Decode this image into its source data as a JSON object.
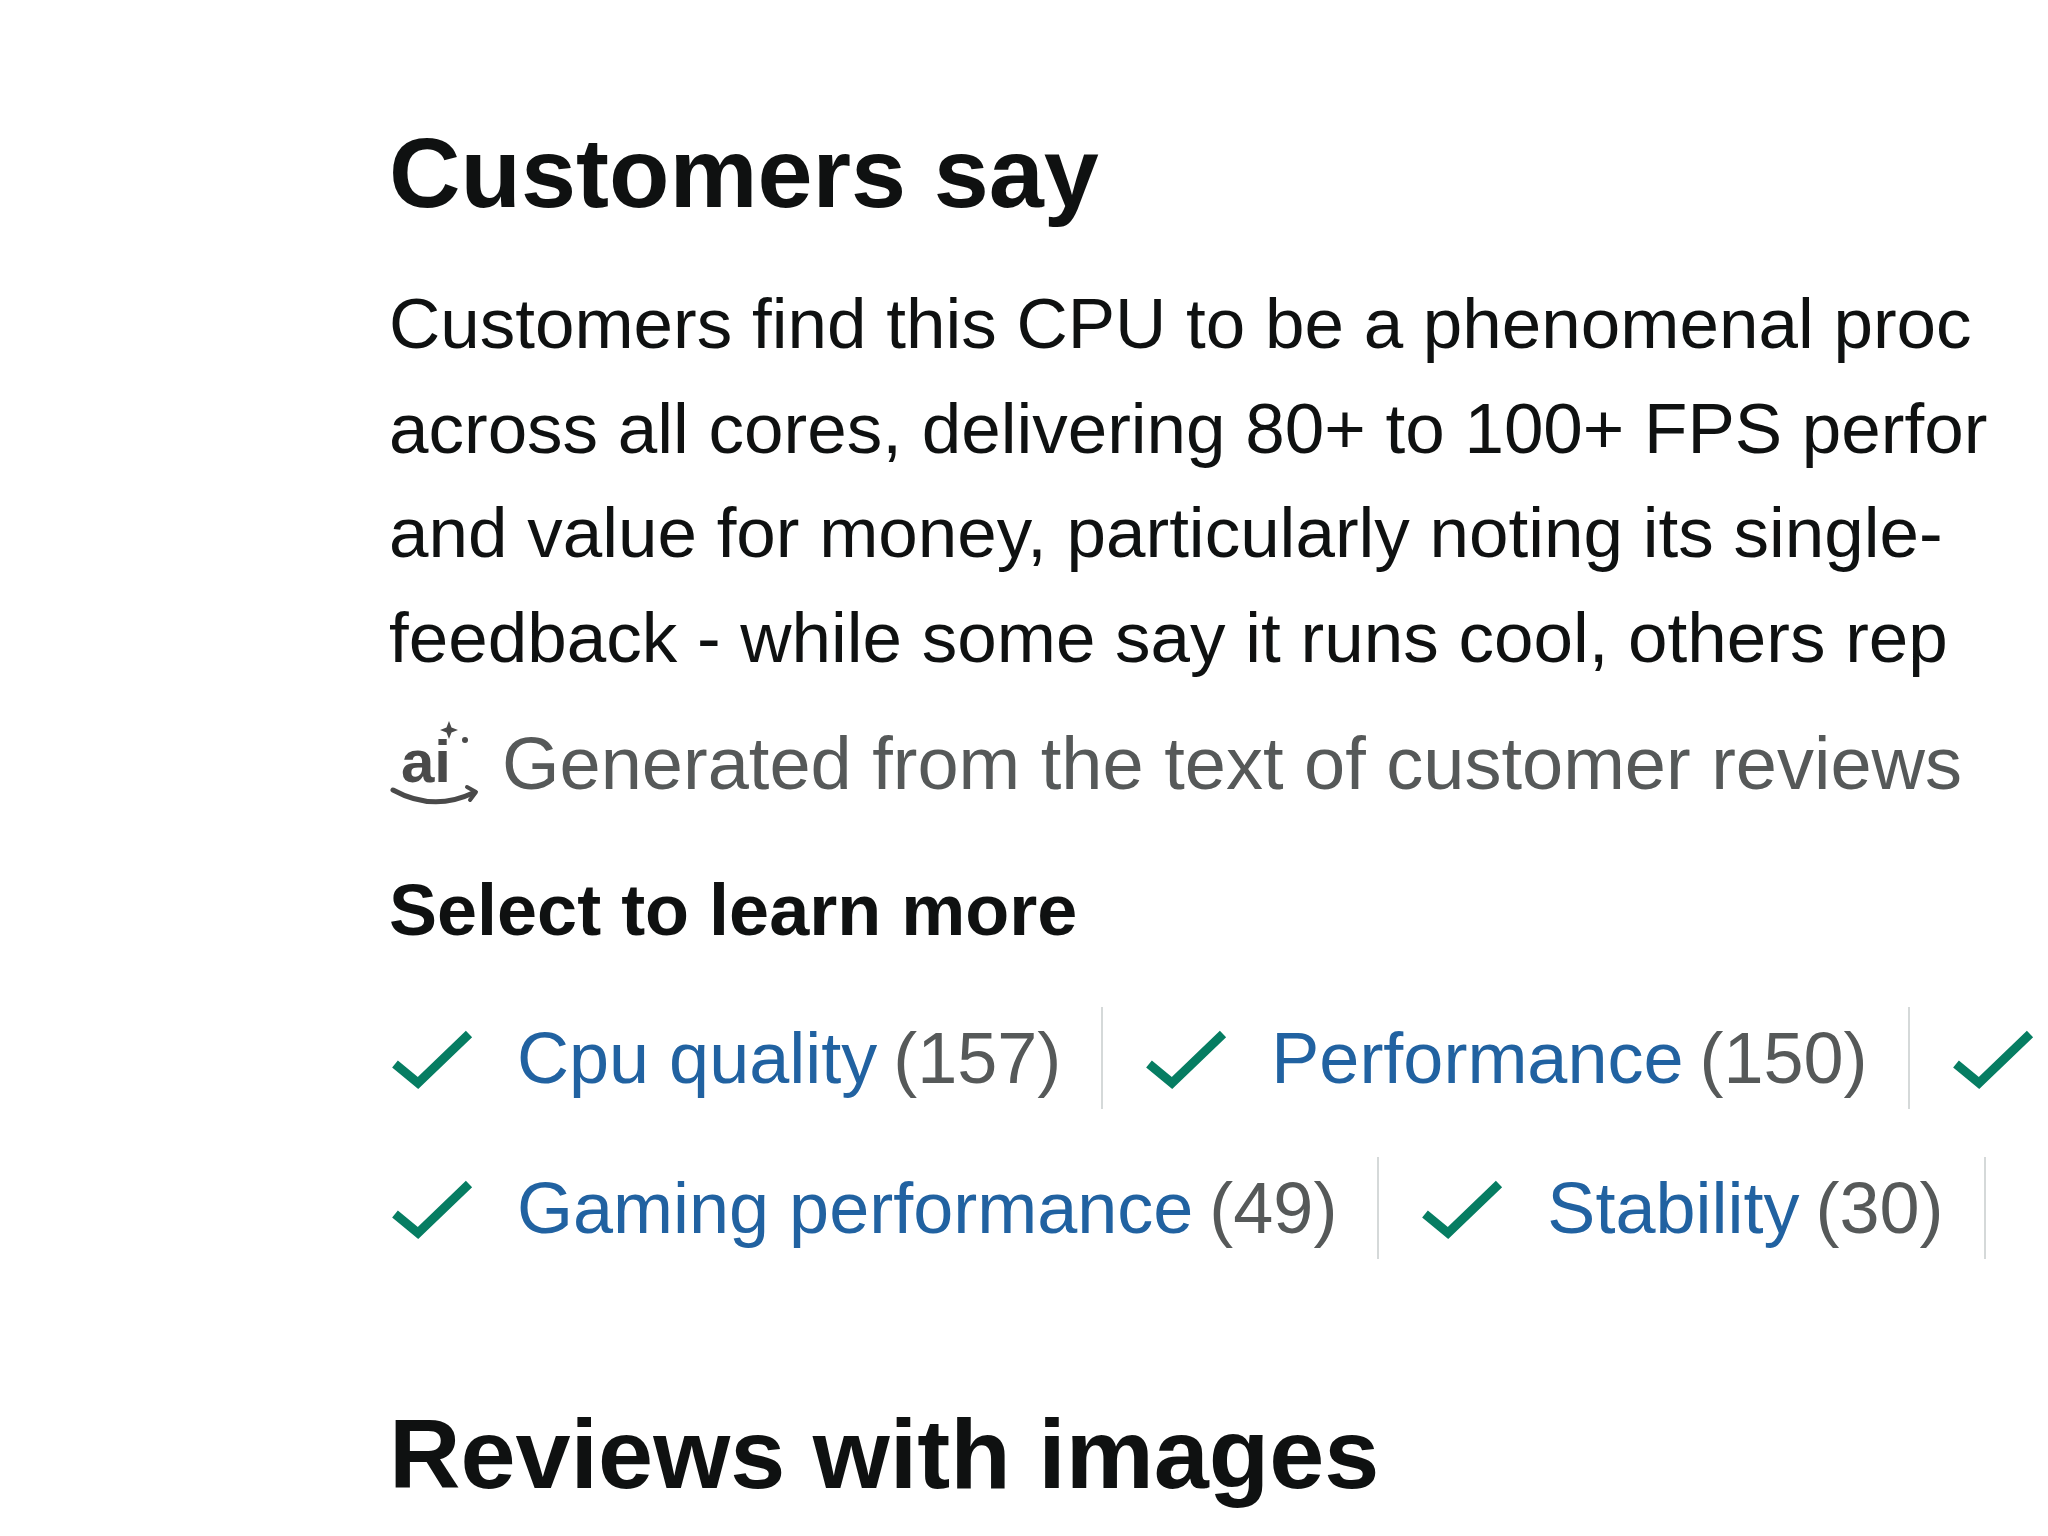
{
  "customers_say": {
    "title": "Customers say",
    "summary_lines": [
      "Customers find this CPU to be a phenomenal proc",
      "across all cores, delivering 80+ to 100+ FPS perfor",
      "and value for money, particularly noting its single-",
      "feedback - while some say it runs cool, others rep"
    ],
    "attribution": {
      "badge": "ai",
      "text": "Generated from the text of customer reviews"
    },
    "prompt": "Select to learn more",
    "topic_rows": [
      [
        {
          "label": "Cpu quality",
          "count": "(157)",
          "kind": "positive"
        },
        {
          "label": "Performance",
          "count": "(150)",
          "kind": "positive"
        },
        {
          "kind": "positive"
        }
      ],
      [
        {
          "label": "Gaming performance",
          "count": "(49)",
          "kind": "positive"
        },
        {
          "label": "Stability",
          "count": "(30)",
          "kind": "positive"
        }
      ]
    ]
  },
  "reviews_with_images": {
    "title": "Reviews with images"
  }
}
